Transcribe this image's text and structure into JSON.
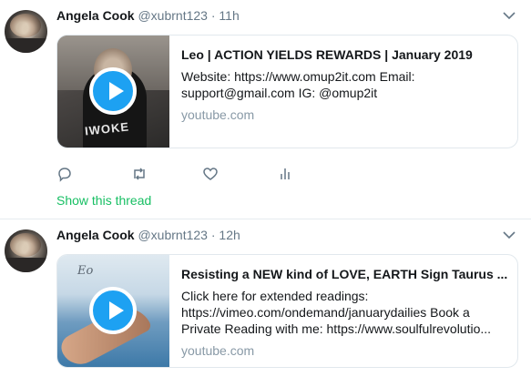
{
  "tweets": [
    {
      "author_name": "Angela Cook",
      "handle": "@xubrnt123",
      "separator": "·",
      "time": "11h",
      "card": {
        "title": "Leo | ACTION YIELDS REWARDS | January 2019",
        "description": "Website: https://www.omup2it.com Email:\nsupport@gmail.com IG: @omup2it",
        "domain": "youtube.com",
        "thumb_text": "IWOKE"
      },
      "actions": [
        "reply-icon",
        "retweet-icon",
        "like-icon",
        "analytics-icon"
      ],
      "show_thread": "Show this thread"
    },
    {
      "author_name": "Angela Cook",
      "handle": "@xubrnt123",
      "separator": "·",
      "time": "12h",
      "card": {
        "title": "Resisting a NEW kind of LOVE, EARTH Sign Taurus ...",
        "description": "Click here for extended readings:\nhttps://vimeo.com/ondemand/januarydailies Book a\nPrivate Reading with me: https://www.soulfulrevolutio...",
        "domain": "youtube.com",
        "thumb_text": "Eo"
      }
    }
  ],
  "colors": {
    "accent": "#1da1f2",
    "thread": "#17bf63",
    "muted": "#657786"
  }
}
